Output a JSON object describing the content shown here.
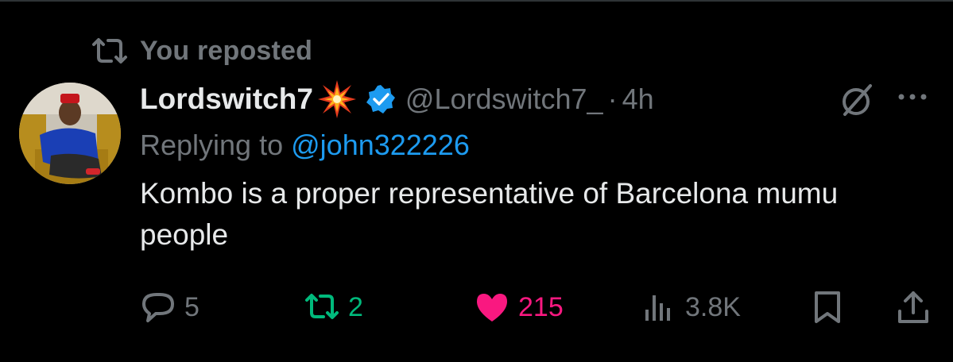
{
  "repost_banner": {
    "text": "You reposted",
    "icon": "repost-icon"
  },
  "author": {
    "display_name": "Lordswitch7",
    "emoji_icon": "collision-burst-icon",
    "verified_icon": "verified-badge-icon",
    "handle": "@Lordswitch7_",
    "separator": "·",
    "time": "4h"
  },
  "reply": {
    "prefix": "Replying to",
    "mention": "@john322226"
  },
  "tweet": {
    "text": "Kombo is a proper representative of Barcelona mumu people"
  },
  "actions": {
    "reply_count": "5",
    "repost_count": "2",
    "like_count": "215",
    "views_count": "3.8K"
  },
  "colors": {
    "background": "#000000",
    "text": "#e7e9ea",
    "muted": "#71767b",
    "link": "#1d9bf0",
    "repost_green": "#00ba7c",
    "like_pink": "#f91880",
    "verified_blue": "#1d9bf0"
  }
}
